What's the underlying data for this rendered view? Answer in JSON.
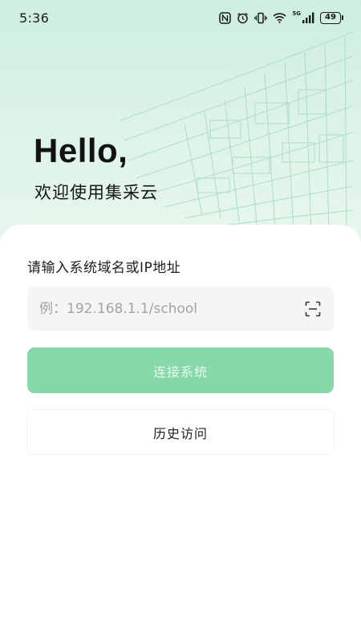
{
  "status_bar": {
    "time": "5:36",
    "network": "5G",
    "battery": "49",
    "icons": [
      "nfc-icon",
      "alarm-icon",
      "vibrate-icon",
      "wifi-icon",
      "signal-icon",
      "battery-icon"
    ]
  },
  "hero": {
    "greeting": "Hello,",
    "welcome": "欢迎使用集采云"
  },
  "form": {
    "label": "请输入系统域名或IP地址",
    "input_value": "",
    "input_placeholder": "例：192.168.1.1/school",
    "scan_icon": "scan-icon",
    "connect_label": "连接系统",
    "history_label": "历史访问"
  },
  "colors": {
    "accent": "#86d8a8",
    "hero_background": "#d6f1e3",
    "input_background": "#f5f5f6"
  }
}
